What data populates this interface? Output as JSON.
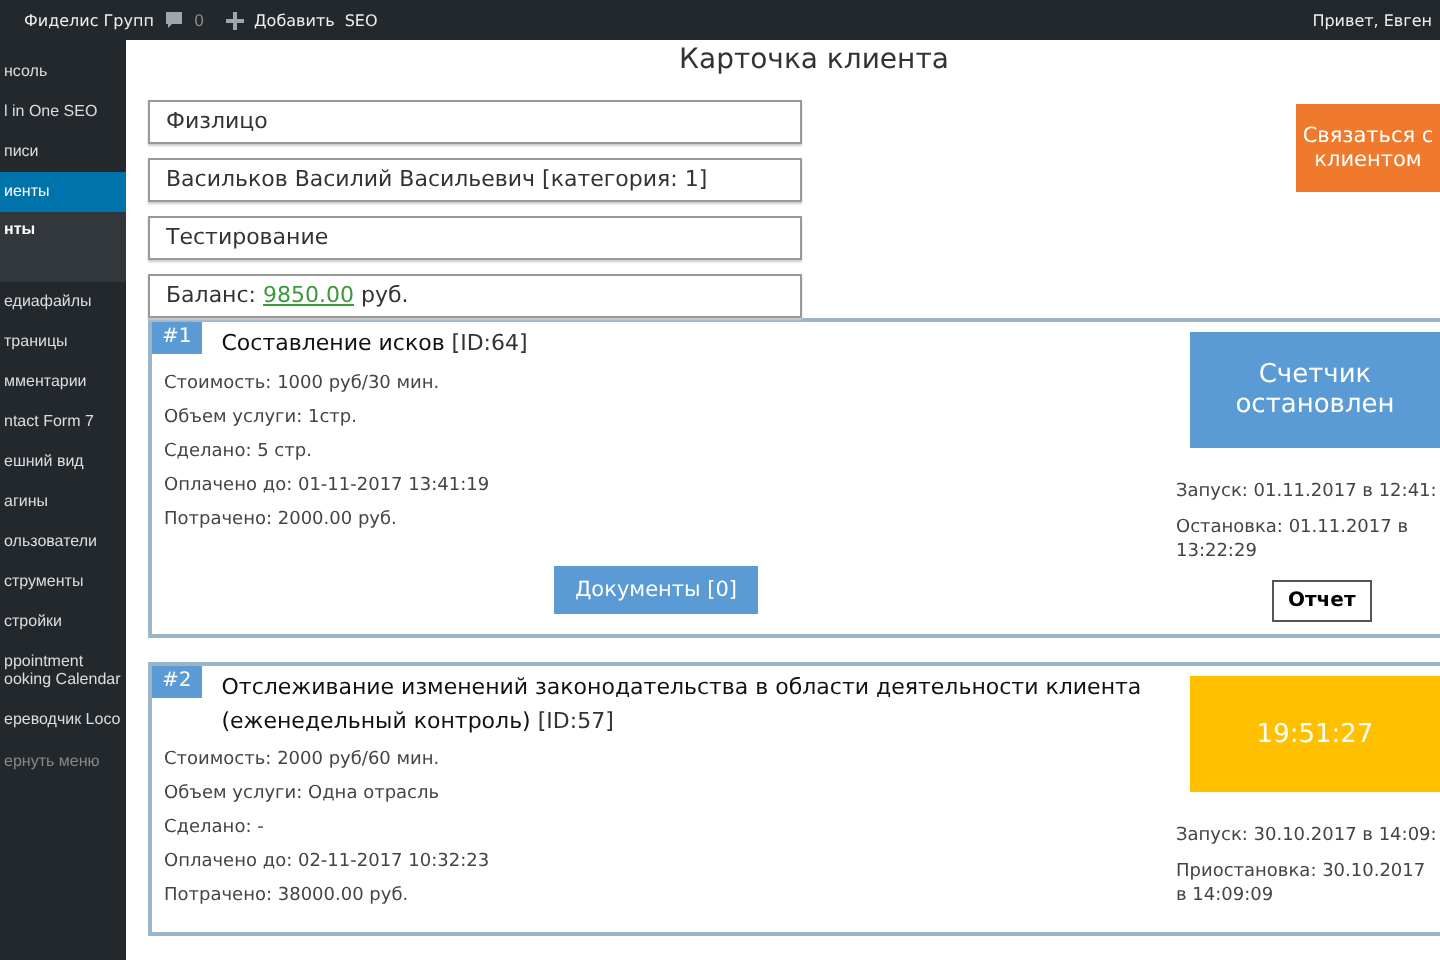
{
  "admin_bar": {
    "site": "Фиделис Групп",
    "comments": "0",
    "add": "Добавить",
    "seo": "SEO",
    "greeting": "Привет, Евген"
  },
  "sidebar": {
    "items": [
      {
        "kind": "item",
        "lines": [
          "нсоль"
        ],
        "selected": false
      },
      {
        "kind": "item",
        "lines": [
          "l in One SEO"
        ],
        "selected": false
      },
      {
        "kind": "item",
        "lines": [
          "писи"
        ],
        "selected": false
      },
      {
        "kind": "item",
        "lines": [
          "иенты"
        ],
        "selected": true
      },
      {
        "kind": "sub",
        "lines": [
          "нты"
        ],
        "selected": true
      },
      {
        "kind": "item",
        "lines": [
          "едиафайлы"
        ],
        "selected": false
      },
      {
        "kind": "item",
        "lines": [
          "траницы"
        ],
        "selected": false
      },
      {
        "kind": "item",
        "lines": [
          "мментарии"
        ],
        "selected": false
      },
      {
        "kind": "item",
        "lines": [
          "ntact Form 7"
        ],
        "selected": false
      },
      {
        "kind": "item",
        "lines": [
          "ешний вид"
        ],
        "selected": false
      },
      {
        "kind": "item",
        "lines": [
          "агины"
        ],
        "selected": false
      },
      {
        "kind": "item",
        "lines": [
          "ользователи"
        ],
        "selected": false
      },
      {
        "kind": "item",
        "lines": [
          "струменты"
        ],
        "selected": false
      },
      {
        "kind": "item",
        "lines": [
          "стройки"
        ],
        "selected": false
      },
      {
        "kind": "item",
        "lines": [
          "ppointment",
          "ooking Calendar"
        ],
        "selected": false
      },
      {
        "kind": "item",
        "lines": [
          "ереводчик Loco"
        ],
        "selected": false
      },
      {
        "kind": "collapse",
        "lines": [
          "ернуть меню"
        ],
        "selected": false
      }
    ]
  },
  "client": {
    "title": "Карточка клиента",
    "fields": [
      "Физлицо",
      "Васильков Василий Васильевич [категория: 1]",
      "Тестирование"
    ],
    "balance": {
      "label": "Баланс:",
      "amount": "9850.00",
      "unit": "руб."
    },
    "contact_button": "Связаться с клиентом"
  },
  "services": [
    {
      "number": "#1",
      "title": "Составление исков",
      "id": "[ID:64]",
      "details": [
        "Стоимость: 1000 руб/30 мин.",
        "Объем услуги: 1стр.",
        "Сделано: 5 стр.",
        "Оплачено до: 01-11-2017 13:41:19",
        "Потрачено: 2000.00 руб."
      ],
      "documents_button": "Документы [0]",
      "timer": {
        "kind": "stopped",
        "text": "Счетчик остановлен"
      },
      "log": [
        "Запуск: 01.11.2017 в 12:41:",
        "Остановка: 01.11.2017 в 13:22:29"
      ],
      "report_button": "Отчет"
    },
    {
      "number": "#2",
      "title": "Отслеживание изменений законодательства в области деятельности клиента (еженедельный контроль)",
      "id": "[ID:57]",
      "details": [
        "Стоимость: 2000 руб/60 мин.",
        "Объем услуги: Одна отрасль",
        "Сделано: -",
        "Оплачено до: 02-11-2017 10:32:23",
        "Потрачено: 38000.00 руб."
      ],
      "timer": {
        "kind": "running",
        "text": "19:51:27"
      },
      "log": [
        "Запуск: 30.10.2017 в 14:09:",
        "Приостановка: 30.10.2017 в 14:09:09"
      ]
    }
  ]
}
